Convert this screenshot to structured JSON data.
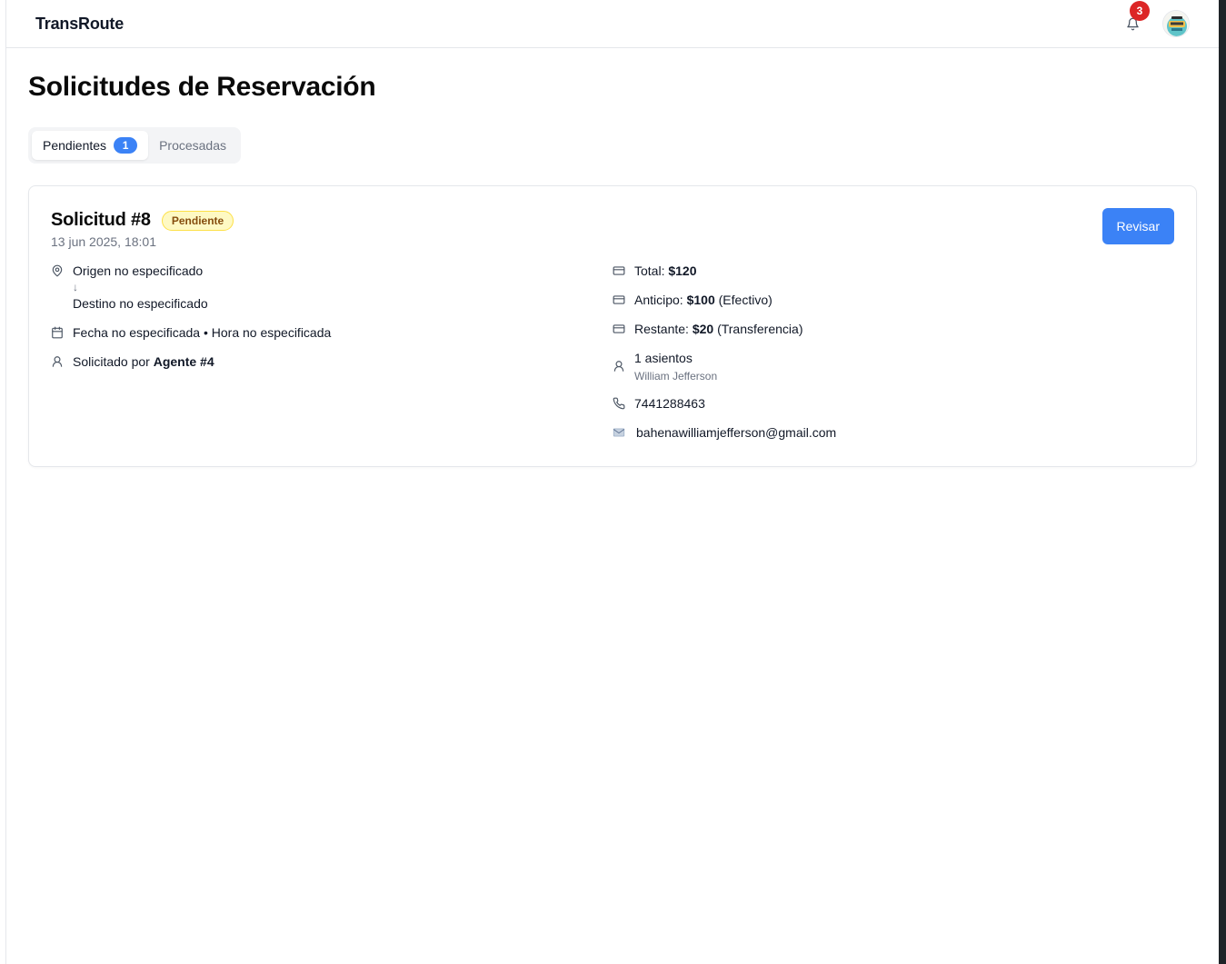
{
  "header": {
    "brand": "TransRoute",
    "notification_count": "3"
  },
  "page": {
    "title": "Solicitudes de Reservación"
  },
  "tabs": [
    {
      "label": "Pendientes",
      "count": "1"
    },
    {
      "label": "Procesadas"
    }
  ],
  "request": {
    "title": "Solicitud #8",
    "status": "Pendiente",
    "date": "13 jun 2025, 18:01",
    "review_label": "Revisar",
    "origin": "Origen no especificado",
    "arrow": "↓",
    "destination": "Destino no especificado",
    "schedule": "Fecha no especificada • Hora no especificada",
    "requested_by_prefix": "Solicitado por",
    "requested_by": "Agente #4",
    "total_label": "Total:",
    "total_value": "$120",
    "advance_label": "Anticipo:",
    "advance_value": "$100",
    "advance_method": "(Efectivo)",
    "remaining_label": "Restante:",
    "remaining_value": "$20",
    "remaining_method": "(Transferencia)",
    "seats": "1 asientos",
    "passenger": "William Jefferson",
    "phone": "7441288463",
    "email": "bahenawilliamjefferson@gmail.com"
  },
  "icons": {
    "bell": "bell-icon",
    "location": "map-pin-icon",
    "calendar": "calendar-icon",
    "user": "user-icon",
    "card": "credit-card-icon",
    "phone": "phone-icon",
    "email": "envelope-icon"
  },
  "colors": {
    "accent": "#3b82f6",
    "notification": "#dc2626",
    "pending_badge_bg": "#fef9c3",
    "pending_badge_text": "#854d0e"
  }
}
